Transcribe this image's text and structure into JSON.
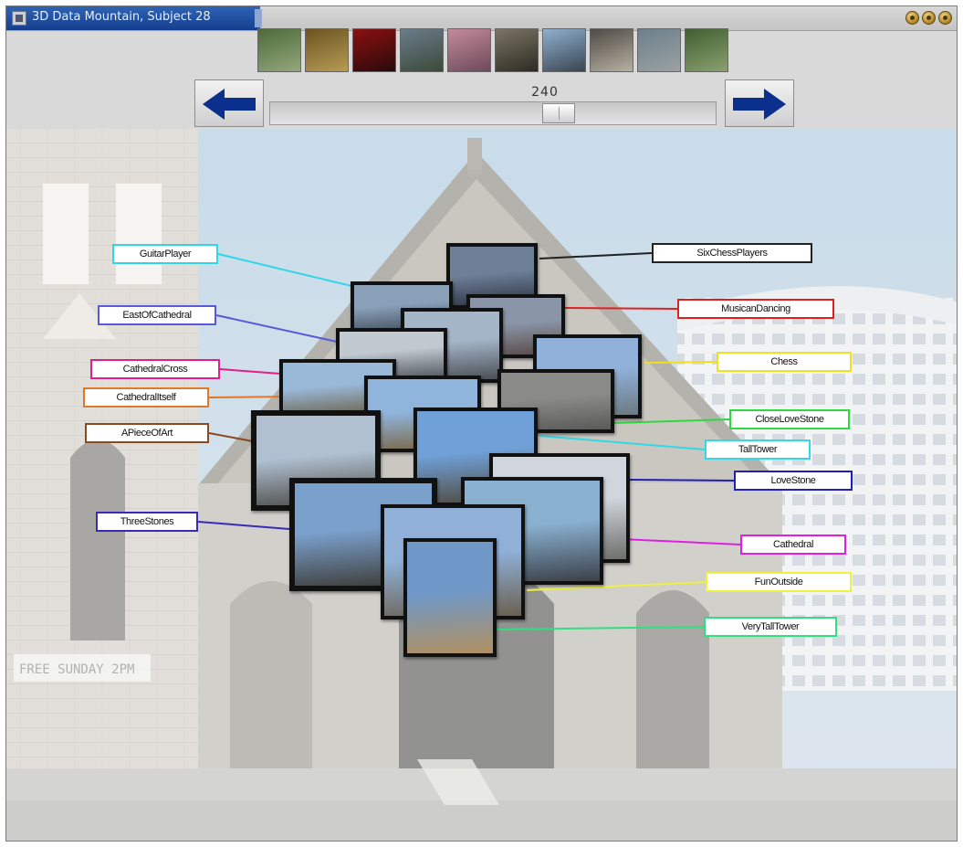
{
  "window": {
    "title": "3D Data Mountain, Subject 28"
  },
  "thumbnails": [
    {
      "name": "thumb-1",
      "c1": "#4d6a3a",
      "c2": "#93a77c"
    },
    {
      "name": "thumb-2",
      "c1": "#6b5320",
      "c2": "#b79b55"
    },
    {
      "name": "thumb-3",
      "c1": "#8b1010",
      "c2": "#2a0a0a"
    },
    {
      "name": "thumb-4",
      "c1": "#6c7c8a",
      "c2": "#3a4a3a"
    },
    {
      "name": "thumb-5",
      "c1": "#c48a9c",
      "c2": "#6d4a58"
    },
    {
      "name": "thumb-6",
      "c1": "#7a7564",
      "c2": "#2e2b22"
    },
    {
      "name": "thumb-7",
      "c1": "#8fb0d0",
      "c2": "#3a4550"
    },
    {
      "name": "thumb-8",
      "c1": "#4e4a44",
      "c2": "#b7b0a2"
    },
    {
      "name": "thumb-9",
      "c1": "#6d7f8a",
      "c2": "#9aa2a3"
    },
    {
      "name": "thumb-10",
      "c1": "#3f5f30",
      "c2": "#8aa070"
    }
  ],
  "navigation": {
    "back_icon": "left-arrow-icon",
    "forward_icon": "right-arrow-icon",
    "arrow_color": "#0a2f8c"
  },
  "slider": {
    "value": "240",
    "position_fraction": 0.66
  },
  "labels": [
    {
      "text": "GuitarPlayer",
      "color": "#2fd6e8"
    },
    {
      "text": "EastOfCathedral",
      "color": "#5a5ad8"
    },
    {
      "text": "CathedralCross",
      "color": "#e0208a"
    },
    {
      "text": "CathedralItself",
      "color": "#e07a2a"
    },
    {
      "text": "APieceOfArt",
      "color": "#8a4a20"
    },
    {
      "text": "ThreeStones",
      "color": "#3a2ab8"
    },
    {
      "text": "SixChessPlayers",
      "color": "#222222"
    },
    {
      "text": "MusicanDancing",
      "color": "#e02020"
    },
    {
      "text": "Chess",
      "color": "#f0e020"
    },
    {
      "text": "CloseLoveStone",
      "color": "#30d840"
    },
    {
      "text": "TallTower",
      "color": "#30d8e8"
    },
    {
      "text": "LoveStone",
      "color": "#2020b8"
    },
    {
      "text": "Cathedral",
      "color": "#e020e0"
    },
    {
      "text": "FunOutside",
      "color": "#f0f040"
    },
    {
      "text": "VeryTallTower",
      "color": "#30e080"
    }
  ],
  "photos": [
    {
      "name": "photo-sixchessplayers",
      "c1": "#6e8098",
      "c2": "#2c3442"
    },
    {
      "name": "photo-guitarplayer",
      "c1": "#8aa0b8",
      "c2": "#43505e"
    },
    {
      "name": "photo-musicandancing",
      "c1": "#8a96a8",
      "c2": "#5a4a48"
    },
    {
      "name": "photo-eastofcathedral",
      "c1": "#a5b5c8",
      "c2": "#4a4f55"
    },
    {
      "name": "photo-street",
      "c1": "#c0c8d0",
      "c2": "#5a5f66"
    },
    {
      "name": "photo-chess",
      "c1": "#8fb0d8",
      "c2": "#6c7a82"
    },
    {
      "name": "photo-cathedralcross",
      "c1": "#9ab8d8",
      "c2": "#6a6048"
    },
    {
      "name": "photo-stonewall",
      "c1": "#8a8a88",
      "c2": "#5a5a58"
    },
    {
      "name": "photo-cathedralitself",
      "c1": "#8fb5dd",
      "c2": "#7a6440"
    },
    {
      "name": "photo-apieceofart",
      "c1": "#b0c0d0",
      "c2": "#4a4a45"
    },
    {
      "name": "photo-talltower",
      "c1": "#6fa0d8",
      "c2": "#50483a"
    },
    {
      "name": "photo-closelovestone",
      "c1": "#d0d6dc",
      "c2": "#6e706c"
    },
    {
      "name": "photo-lovestone",
      "c1": "#8ab0d0",
      "c2": "#3a4048"
    },
    {
      "name": "photo-threestones",
      "c1": "#7aa0cc",
      "c2": "#3c3a34"
    },
    {
      "name": "photo-funoutside",
      "c1": "#90b0d8",
      "c2": "#6a6050"
    },
    {
      "name": "photo-verytalltower",
      "c1": "#6f98c8",
      "c2": "#b09060"
    }
  ]
}
